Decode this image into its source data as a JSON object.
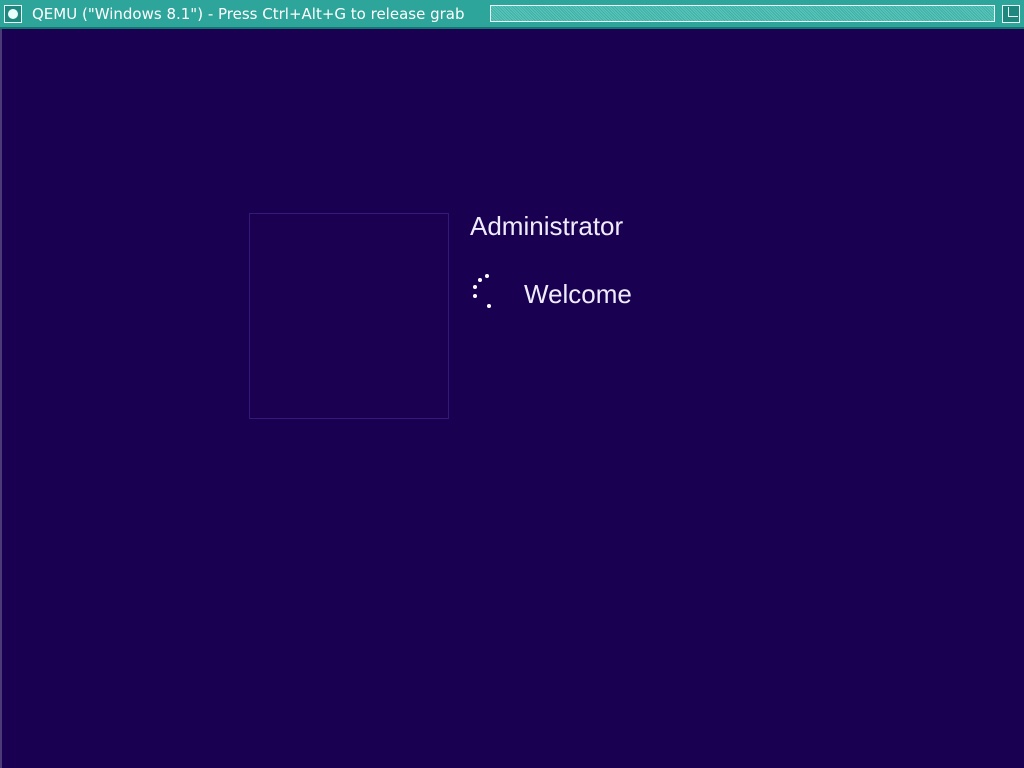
{
  "window": {
    "title": "QEMU (\"Windows 8.1\") - Press Ctrl+Alt+G to release grab",
    "colors": {
      "titlebar": "#2ea59a",
      "screen_background": "#1a0050",
      "text": "#f0ecff"
    }
  },
  "login": {
    "user_name": "Administrator",
    "status": "Welcome"
  },
  "icons": {
    "window_menu": "window-menu-icon",
    "maximize": "maximize-icon",
    "spinner": "loading-spinner-icon"
  }
}
